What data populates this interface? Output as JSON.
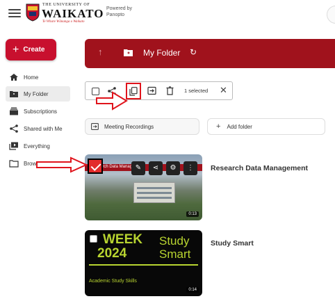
{
  "header": {
    "logo_small": "THE UNIVERSITY OF",
    "logo_big": "WAIKATO",
    "logo_motto": "Te Whare Wānanga o Waikato",
    "powered_by": "Powered by Panopto"
  },
  "sidebar": {
    "create_label": "Create",
    "items": [
      {
        "label": "Home",
        "icon": "home-icon"
      },
      {
        "label": "My Folder",
        "icon": "folder-icon"
      },
      {
        "label": "Subscriptions",
        "icon": "subscriptions-icon"
      },
      {
        "label": "Shared with Me",
        "icon": "share-icon"
      },
      {
        "label": "Everything",
        "icon": "library-icon"
      },
      {
        "label": "Browse",
        "icon": "browse-folder-icon"
      }
    ]
  },
  "banner": {
    "title": "My Folder",
    "accent": "#a0121c"
  },
  "toolbar": {
    "selected_text": "1 selected"
  },
  "folders": {
    "meeting": "Meeting Recordings",
    "add": "Add folder"
  },
  "videos": [
    {
      "title": "Research Data Management",
      "duration": "0:13",
      "thumb_caption": "Research Data Management",
      "selected": true
    },
    {
      "title": "Study Smart",
      "duration": "0:14",
      "thumb_week": "WEEK",
      "thumb_year": "2024",
      "thumb_study": "Study",
      "thumb_smart": "Smart",
      "thumb_sub": "Academic Study Skills",
      "selected": false
    }
  ],
  "colors": {
    "brand_red": "#c8102e",
    "annotation_red": "#e0141c",
    "study_green": "#b8d430"
  }
}
